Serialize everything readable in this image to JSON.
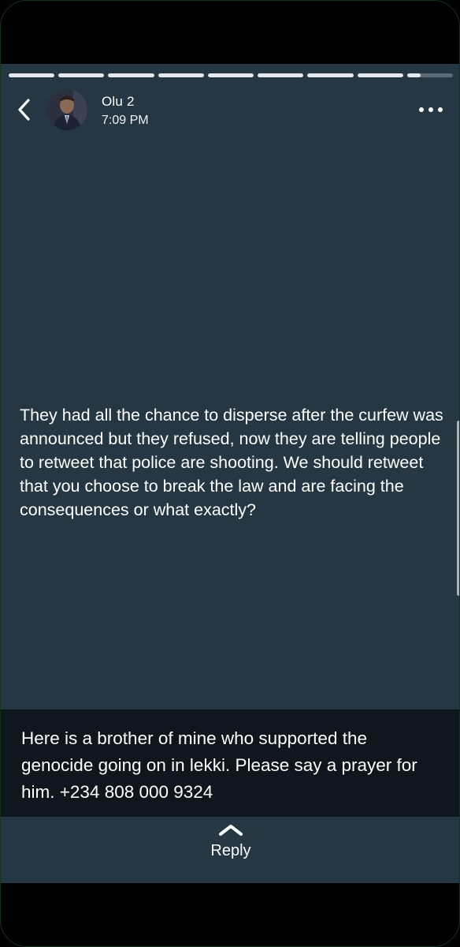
{
  "progress": {
    "segments_total": 9,
    "current_segment_fill": 0.3
  },
  "header": {
    "user_name": "Olu 2",
    "time": "7:09 PM",
    "back_icon": "chevron-left-icon",
    "more_icon": "more-horizontal-icon"
  },
  "story": {
    "text": "They had all the chance to disperse after the curfew was announced but they refused, now they are telling people to retweet that police are shooting. We should retweet that you choose to break the law and are facing the consequences or what exactly?"
  },
  "caption": {
    "text": "Here is a brother of mine who supported the genocide going on in lekki. Please say a prayer for him. +234 808 000 9324"
  },
  "reply": {
    "label": "Reply",
    "icon": "chevron-up-icon"
  },
  "colors": {
    "background": "#253743",
    "caption_background": "#0c1217",
    "text": "#ffffff"
  }
}
